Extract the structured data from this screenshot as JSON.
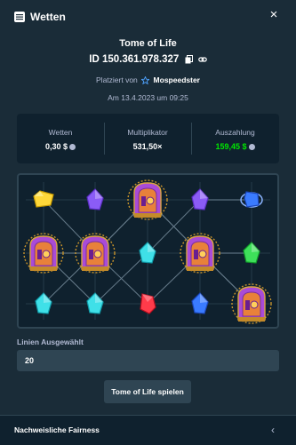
{
  "header": {
    "title": "Wetten",
    "close_label": "×"
  },
  "bet": {
    "game": "Tome of Life",
    "id": "ID 150.361.978.327",
    "placed_prefix": "Platziert von",
    "user": "Mospeedster",
    "date": "Am 13.4.2023 um 09:25"
  },
  "stats": {
    "bet_label": "Wetten",
    "bet_value": "0,30 $",
    "mult_label": "Multiplikator",
    "mult_value": "531,50×",
    "payout_label": "Auszahlung",
    "payout_value": "159,45 $"
  },
  "board": {
    "grid": [
      [
        "gem-yellow",
        "gem-purple",
        "book",
        "gem-purple",
        "gem-blue"
      ],
      [
        "book",
        "book",
        "gem-cyan",
        "book",
        "gem-green"
      ],
      [
        "gem-cyan",
        "gem-cyan",
        "gem-red",
        "gem-blue",
        "book"
      ]
    ]
  },
  "lines": {
    "label": "Linien Ausgewählt",
    "value": "20"
  },
  "play_button": "Tome of Life spielen",
  "footer": {
    "title": "Nachweisliche Fairness",
    "chevron": "‹"
  },
  "colors": {
    "bg": "#1a2c38",
    "panel": "#0f212e",
    "green": "#00e701"
  }
}
